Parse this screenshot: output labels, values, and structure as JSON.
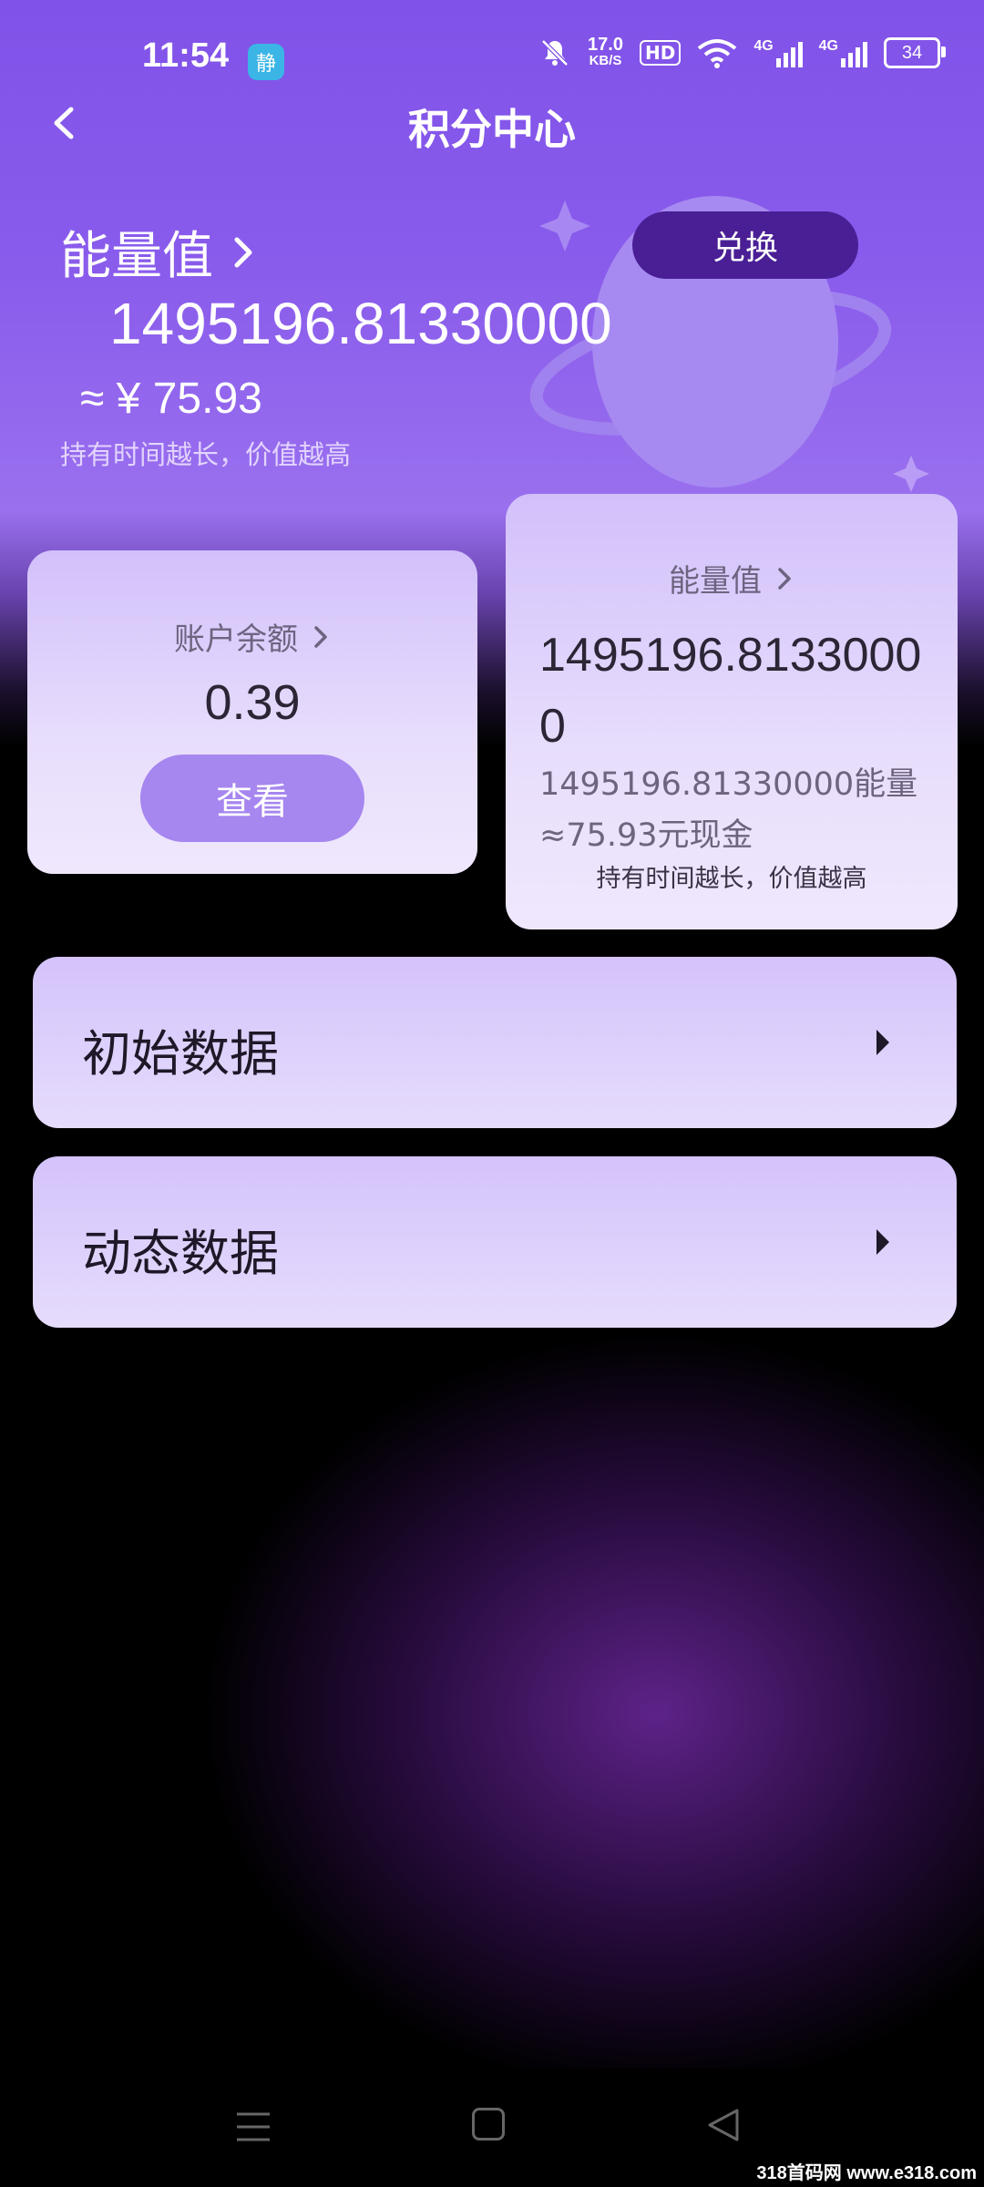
{
  "status_bar": {
    "time": "11:54",
    "badge": "静",
    "speed_value": "17.0",
    "speed_unit": "KB/S",
    "hd": "HD",
    "signal1": "4G",
    "signal2": "4G",
    "battery": "34"
  },
  "header": {
    "title": "积分中心"
  },
  "hero": {
    "energy_label": "能量值",
    "energy_value": "1495196.81330000",
    "cash_value": "≈ ¥ 75.93",
    "hint": "持有时间越长，价值越高",
    "exchange_label": "兑换"
  },
  "balance_card": {
    "label": "账户余额",
    "value": "0.39",
    "button_label": "查看"
  },
  "energy_card": {
    "label": "能量值",
    "value": "1495196.81330000",
    "line1": "1495196.81330000能量",
    "line2": "≈75.93元现金",
    "hint": "持有时间越长，价值越高"
  },
  "menu": {
    "items": [
      {
        "label": "初始数据"
      },
      {
        "label": "动态数据"
      }
    ]
  },
  "watermark": "318首码网 www.e318.com",
  "colors": {
    "primary": "#8052e8",
    "exchange_button": "#4a1f95",
    "view_button": "#a686ef"
  }
}
